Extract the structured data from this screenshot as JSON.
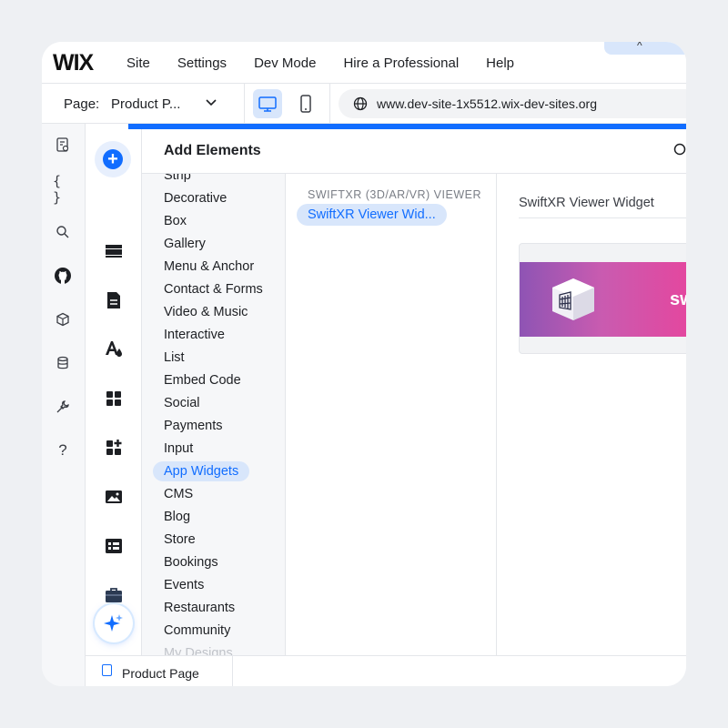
{
  "app": {
    "logo": "WIX",
    "menu": [
      "Site",
      "Settings",
      "Dev Mode",
      "Hire a Professional",
      "Help"
    ],
    "collapse_glyph": "^"
  },
  "pagebar": {
    "page_label": "Page:",
    "page_value": "Product P...",
    "url": "www.dev-site-1x5512.wix-dev-sites.org"
  },
  "panel": {
    "title": "Add Elements",
    "categories": [
      "Strip",
      "Decorative",
      "Box",
      "Gallery",
      "Menu & Anchor",
      "Contact & Forms",
      "Video & Music",
      "Interactive",
      "List",
      "Embed Code",
      "Social",
      "Payments",
      "Input",
      "App Widgets",
      "CMS",
      "Blog",
      "Store",
      "Bookings",
      "Events",
      "Restaurants",
      "Community",
      "My Designs"
    ],
    "selected_category": "App Widgets",
    "sub_heading": "SWIFTXR (3D/AR/VR) VIEWER",
    "sub_item": "SwiftXR Viewer Wid...",
    "preview_title": "SwiftXR Viewer Widget",
    "preview_brand": "sw"
  },
  "bottom": {
    "page_tab": "Product Page"
  },
  "colors": {
    "accent": "#116dff",
    "selected_bg": "#d8e6fb"
  },
  "icons": {
    "rail": [
      "pages-icon",
      "code-icon",
      "search-icon",
      "github-icon",
      "package-icon",
      "database-icon",
      "tools-icon",
      "help-icon"
    ],
    "tools": [
      "add-elements-icon",
      "sections-icon",
      "pages-doc-icon",
      "theme-icon",
      "apps-icon",
      "add-apps-icon",
      "media-icon",
      "cms-icon",
      "business-icon",
      "ai-assistant-icon"
    ]
  }
}
